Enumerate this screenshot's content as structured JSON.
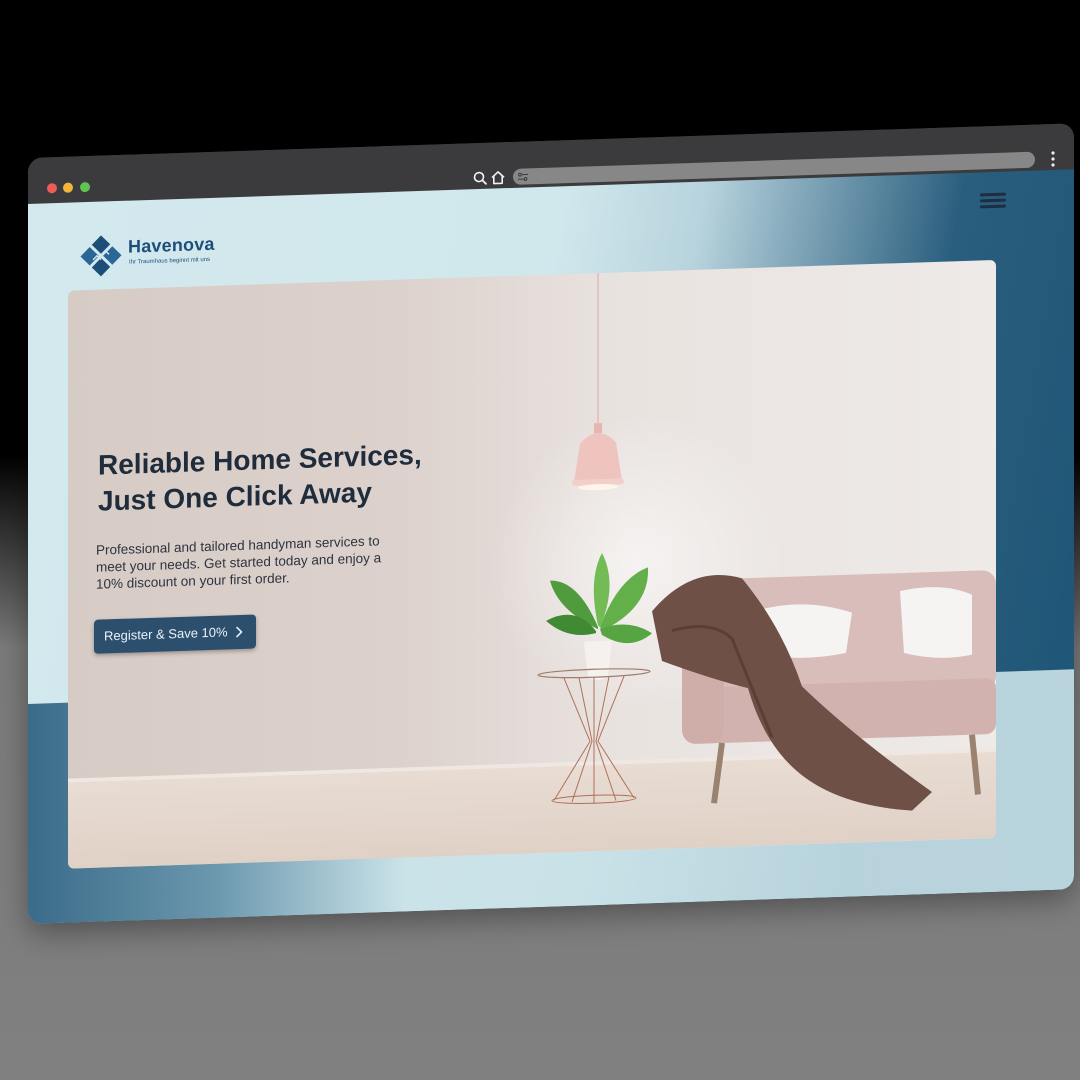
{
  "browser": {
    "icons": [
      "search-icon",
      "home-icon",
      "site-settings-icon",
      "more-vertical-icon"
    ],
    "window_controls": [
      "close",
      "minimize",
      "maximize"
    ]
  },
  "site": {
    "brand": "Havenova",
    "tagline": "Ihr Traumhaus beginnt mit uns"
  },
  "header": {
    "menu_icon": "hamburger-icon"
  },
  "hero": {
    "title_line1": "Reliable Home Services,",
    "title_line2": "Just One Click Away",
    "description": "Professional and tailored handyman services to meet your needs. Get started today and enjoy a 10% discount on your first order.",
    "cta_label": "Register & Save 10%",
    "cta_icon": "chevron-right-icon",
    "image": "living-room-photo"
  },
  "colors": {
    "brand": "#1d4e7a",
    "cta_background": "#2c4f6e",
    "heading": "#1f2c3b"
  }
}
